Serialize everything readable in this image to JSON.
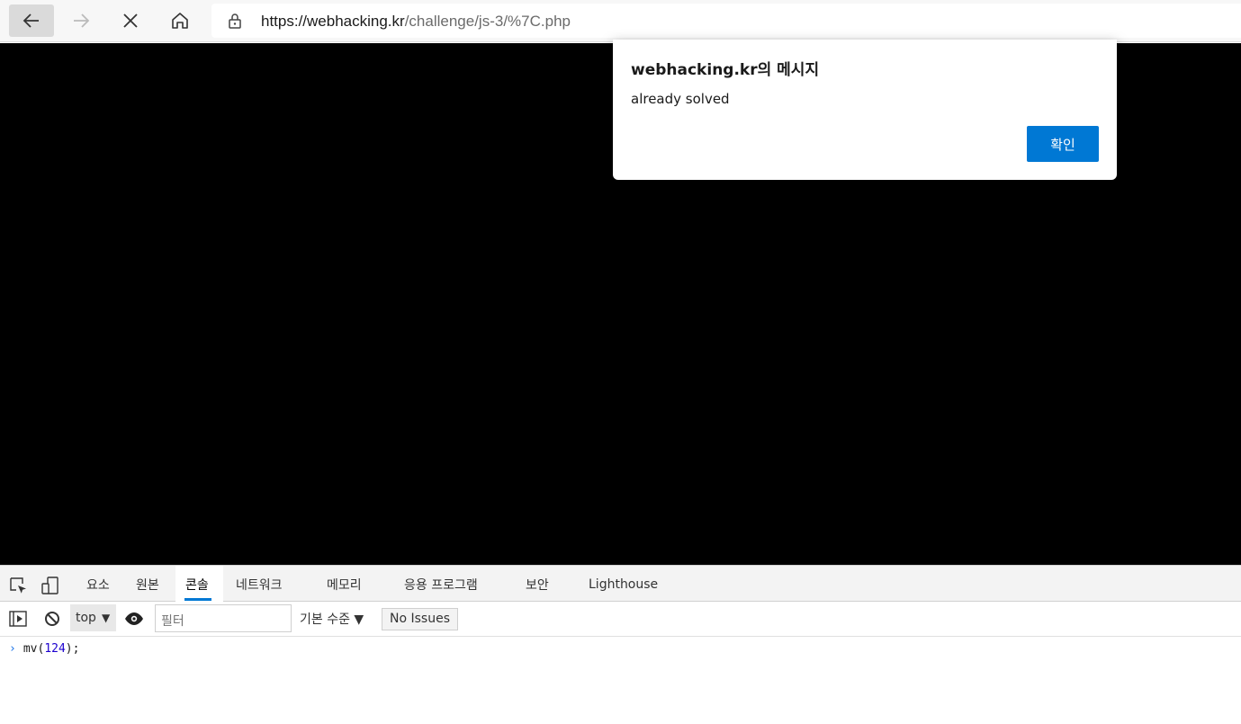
{
  "browser": {
    "url_host": "https://webhacking.kr",
    "url_path": "/challenge/js-3/%7C.php"
  },
  "dialog": {
    "title": "webhacking.kr의 메시지",
    "message": "already solved",
    "ok_label": "확인"
  },
  "devtools": {
    "tabs": [
      "요소",
      "원본",
      "콘솔",
      "네트워크",
      "메모리",
      "응용 프로그램",
      "보안",
      "Lighthouse"
    ],
    "active_tab": "콘솔",
    "context": "top",
    "filter_placeholder": "필터",
    "level": "기본 수준 ▼",
    "issues": "No Issues",
    "console": {
      "cmd_prefix": "mv(",
      "cmd_number": "124",
      "cmd_suffix": ");"
    }
  },
  "colors": {
    "accent": "#0078d4",
    "page_bg": "#000000"
  }
}
